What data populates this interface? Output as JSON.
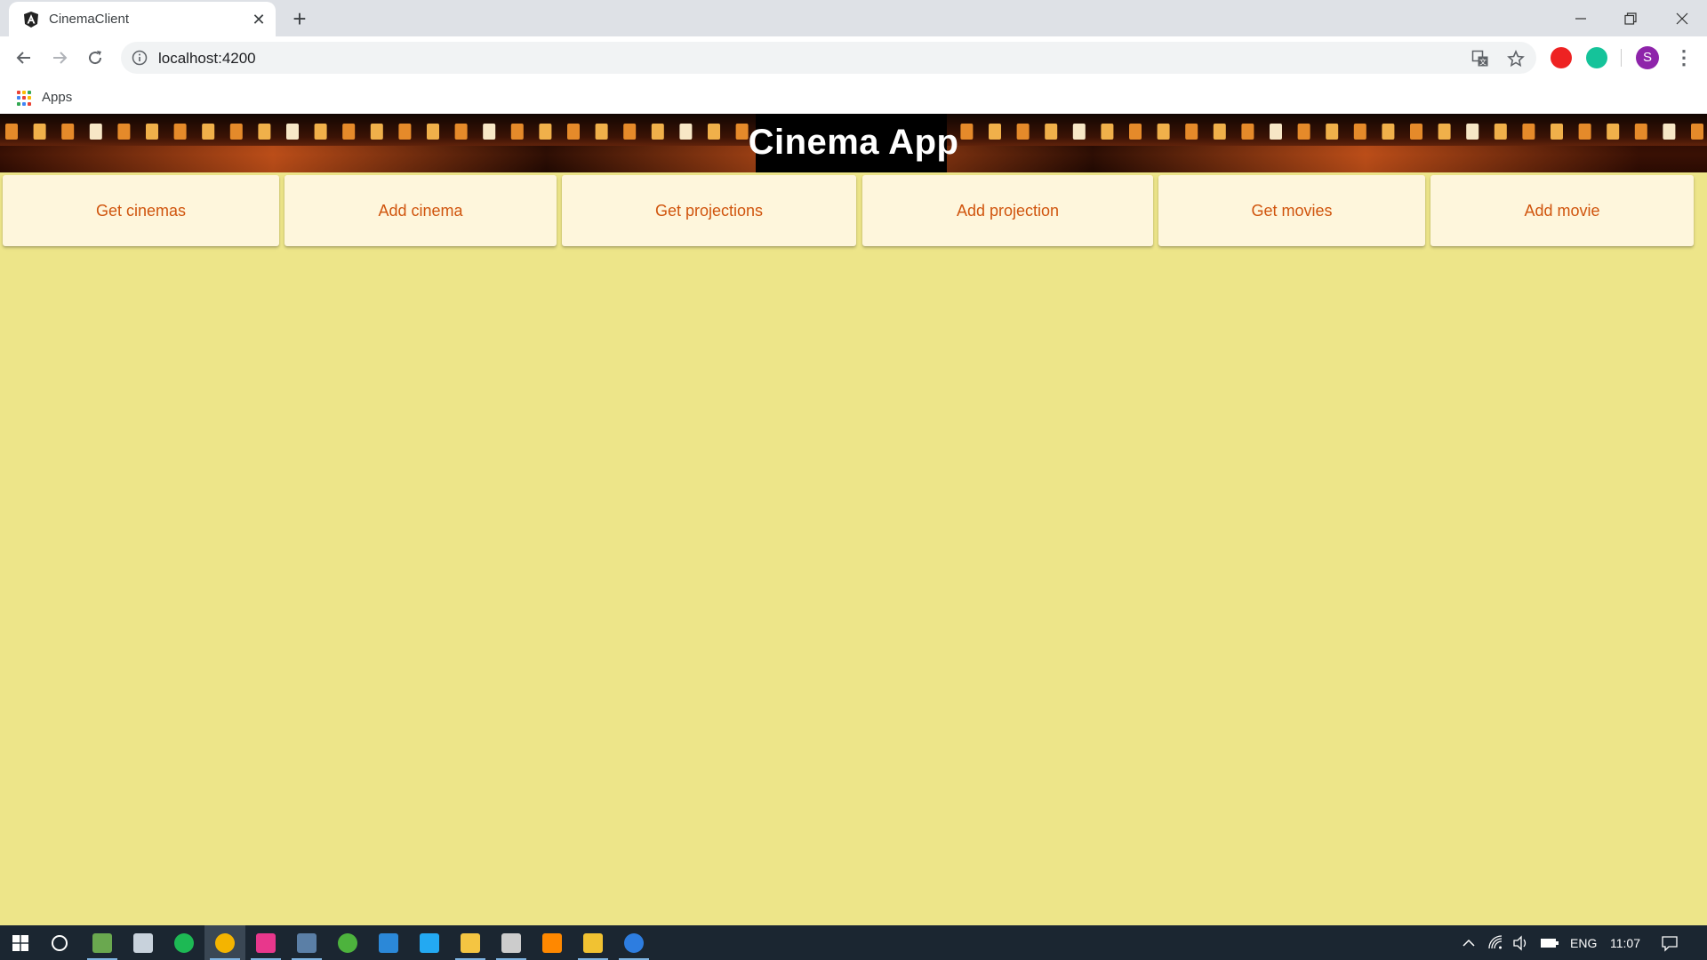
{
  "browser": {
    "tab_title": "CinemaClient",
    "tab_close": "✕",
    "new_tab": "+",
    "url": "localhost:4200",
    "avatar_initial": "S",
    "menu": "⋮",
    "bookmarks": {
      "apps_label": "Apps"
    },
    "apps_colors": [
      "#ea4335",
      "#fbbc05",
      "#34a853",
      "#4285f4",
      "#ea4335",
      "#fbbc05",
      "#34a853",
      "#4285f4",
      "#ea4335"
    ]
  },
  "page": {
    "title": "Cinema App",
    "accent_color": "#d0550e",
    "background_color": "#ede589",
    "card_color": "#fef6dc",
    "nav": [
      {
        "label": "Get cinemas"
      },
      {
        "label": "Add cinema"
      },
      {
        "label": "Get projections"
      },
      {
        "label": "Add projection"
      },
      {
        "label": "Get movies"
      },
      {
        "label": "Add movie"
      }
    ]
  },
  "taskbar": {
    "apps": [
      {
        "name": "cortana-icon"
      },
      {
        "name": "notepad-icon",
        "color": "#6aa84f"
      },
      {
        "name": "steam-icon",
        "color": "#c8d2dc"
      },
      {
        "name": "spotify-icon",
        "color": "#1db954"
      },
      {
        "name": "chrome-icon",
        "color": "#f4b400"
      },
      {
        "name": "intellij-icon",
        "color": "#e8378c"
      },
      {
        "name": "network-tool-icon",
        "color": "#5b7fa6"
      },
      {
        "name": "mongodb-compass-icon",
        "color": "#4db33d"
      },
      {
        "name": "upload-app-icon",
        "color": "#2b88d8"
      },
      {
        "name": "vscode-icon",
        "color": "#23a9f2"
      },
      {
        "name": "file-explorer-icon",
        "color": "#f4c542"
      },
      {
        "name": "terminal-icon",
        "color": "#cccccc"
      },
      {
        "name": "vlc-icon",
        "color": "#ff8800"
      },
      {
        "name": "git-icon",
        "color": "#f1c232"
      },
      {
        "name": "edge-icon",
        "color": "#2d7de0"
      }
    ],
    "language": "ENG",
    "time": "11:07"
  }
}
